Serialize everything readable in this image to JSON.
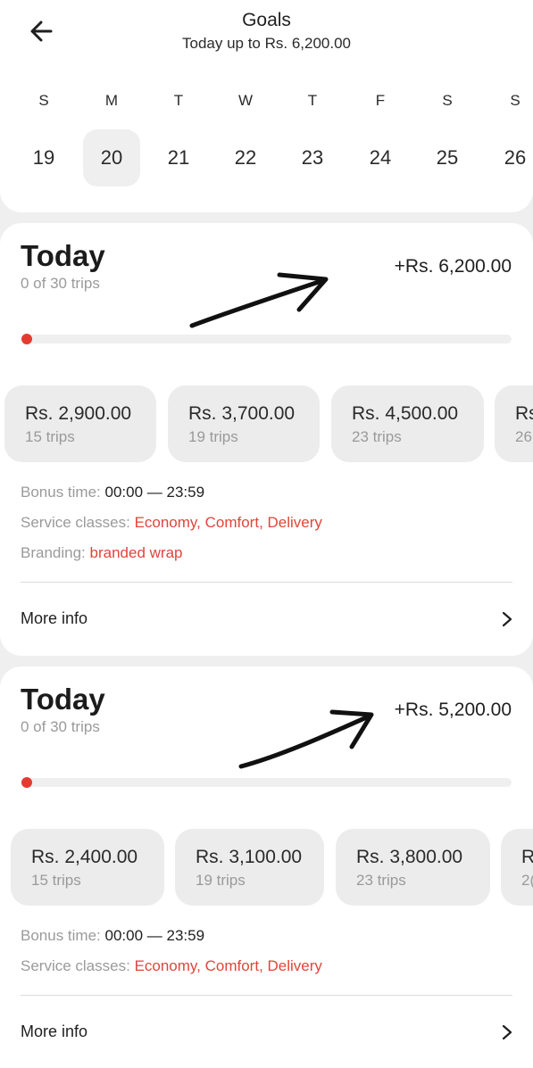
{
  "header": {
    "title": "Goals",
    "subtitle": "Today up to Rs. 6,200.00"
  },
  "calendar": {
    "days": [
      {
        "dow": "S",
        "date": "19",
        "selected": false
      },
      {
        "dow": "M",
        "date": "20",
        "selected": true
      },
      {
        "dow": "T",
        "date": "21",
        "selected": false
      },
      {
        "dow": "W",
        "date": "22",
        "selected": false
      },
      {
        "dow": "T",
        "date": "23",
        "selected": false
      },
      {
        "dow": "F",
        "date": "24",
        "selected": false
      },
      {
        "dow": "S",
        "date": "25",
        "selected": false
      },
      {
        "dow": "S",
        "date": "26",
        "selected": false
      }
    ]
  },
  "cards": [
    {
      "title": "Today",
      "trips_progress": "0 of 30 trips",
      "reward": "+Rs. 6,200.00",
      "progress_fraction": 0,
      "tiers": [
        {
          "amount": "Rs. 2,900.00",
          "trips": "15 trips"
        },
        {
          "amount": "Rs. 3,700.00",
          "trips": "19 trips"
        },
        {
          "amount": "Rs. 4,500.00",
          "trips": "23 trips"
        },
        {
          "amount": "Rs",
          "trips": "26"
        }
      ],
      "bonus_label": "Bonus time:",
      "bonus_value": "00:00 — 23:59",
      "service_label": "Service classes:",
      "service_value": "Economy, Comfort, Delivery",
      "branding_label": "Branding:",
      "branding_value": "branded wrap",
      "more_info": "More info"
    },
    {
      "title": "Today",
      "trips_progress": "0 of 30 trips",
      "reward": "+Rs. 5,200.00",
      "progress_fraction": 0,
      "tiers": [
        {
          "amount": "Rs. 2,400.00",
          "trips": "15 trips"
        },
        {
          "amount": "Rs. 3,100.00",
          "trips": "19 trips"
        },
        {
          "amount": "Rs. 3,800.00",
          "trips": "23 trips"
        },
        {
          "amount": "R",
          "trips": "2("
        }
      ],
      "bonus_label": "Bonus time:",
      "bonus_value": "00:00 — 23:59",
      "service_label": "Service classes:",
      "service_value": "Economy, Comfort, Delivery",
      "more_info": "More info"
    }
  ],
  "colors": {
    "accent_red": "#e53b2f",
    "background": "#efefef",
    "card": "#ffffff",
    "tier_bg": "#ececec"
  },
  "icons": [
    "back-arrow-icon",
    "chevron-right-icon",
    "handdrawn-arrow-annotation"
  ]
}
